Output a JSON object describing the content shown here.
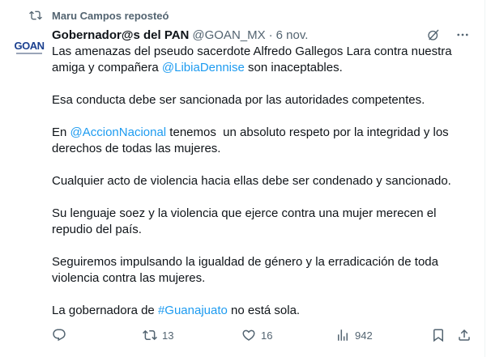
{
  "repost": {
    "label": "Maru Campos reposteó",
    "icon": "repost-icon"
  },
  "author": {
    "avatar_text": "GOAN",
    "name": "Gobernador@s del PAN",
    "handle": "@GOAN_MX",
    "separator": "·",
    "date": "6 nov."
  },
  "tweet": {
    "p1a": "Las amenazas del pseudo sacerdote Alfredo Gallegos Lara contra nuestra amiga y compañera ",
    "mention1": "@LibiaDennise",
    "p1b": " son inaceptables.",
    "p2": "Esa conducta debe ser sancionada por las autoridades competentes.",
    "p3a": "En ",
    "mention2": "@AccionNacional",
    "p3b": " tenemos  un absoluto respeto por la integridad y los derechos de todas las mujeres.",
    "p4": "Cualquier acto de violencia hacia ellas debe ser condenado y sancionado.",
    "p5": "Su lenguaje soez y la violencia que ejerce contra una mujer merecen el repudio del país.",
    "p6": "Seguiremos impulsando la igualdad de género y la erradicación de toda violencia contra las mujeres.",
    "p7a": "La gobernadora de ",
    "hashtag": "#Guanajuato",
    "p7b": " no está sola."
  },
  "actions": {
    "reply_count": "",
    "repost_count": "13",
    "like_count": "16",
    "views_count": "942"
  },
  "colors": {
    "link": "#1d9bf0",
    "muted": "#536471",
    "text": "#0f1419",
    "brand": "#1a3f8f"
  }
}
